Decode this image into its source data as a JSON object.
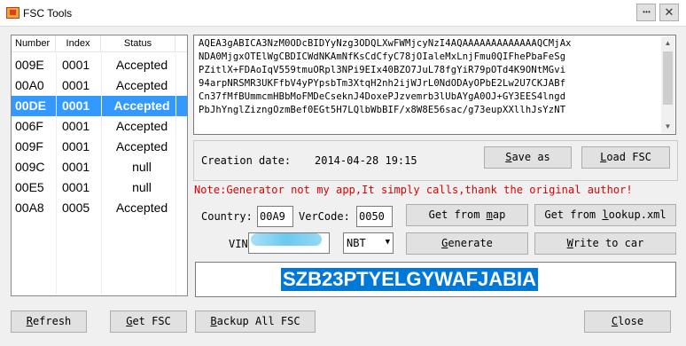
{
  "window": {
    "title": "FSC Tools",
    "help_label": "• • •",
    "close_glyph": "✕"
  },
  "listview": {
    "headers": [
      "Number",
      "Index",
      "Status"
    ],
    "rows": [
      {
        "number": "009E",
        "index": "0001",
        "status": "Accepted",
        "selected": false
      },
      {
        "number": "00A0",
        "index": "0001",
        "status": "Accepted",
        "selected": false
      },
      {
        "number": "00DE",
        "index": "0001",
        "status": "Accepted",
        "selected": true
      },
      {
        "number": "006F",
        "index": "0001",
        "status": "Accepted",
        "selected": false
      },
      {
        "number": "009F",
        "index": "0001",
        "status": "Accepted",
        "selected": false
      },
      {
        "number": "009C",
        "index": "0001",
        "status": "null",
        "selected": false
      },
      {
        "number": "00E5",
        "index": "0001",
        "status": "null",
        "selected": false
      },
      {
        "number": "00A8",
        "index": "0005",
        "status": "Accepted",
        "selected": false
      }
    ]
  },
  "key_text": [
    "AQEA3gABICA3NzM0ODcBIDYyNzg3ODQLXwFWMjcyNzI4AQAAAAAAAAAAAAAQCMjAx",
    "NDA0MjgxOTElWgCBDICWdNKAmNfKsCdCfyC78jOIaleMxLnjFmu0QIFhePbaFeSg",
    "PZitlX+FDAoIqV559tmuORpl3NPi9EIx40BZO7JuL78fgYiR79pOTd4K9ONtMGvi",
    "94arpNRSMR3UKFfbV4yPYpsbTm3XtqH2nh2ijWJrL0NdODAyOPbE2Lw2U7CKJABf",
    "Cn37fMfBUmmcmHBbMoFMDeCseknJ4DoxePJzvemrb3lUbAYgA0OJ+GY3EES4lngd",
    "PbJhYnglZizngOzmBef0EGt5H7LQlbWbBIF/x8W8E56sac/g73eupXXllhJsYzNT"
  ],
  "creation": {
    "label": "Creation date:",
    "value": "2014-04-28 19:15"
  },
  "buttons": {
    "save_as": {
      "key": "S",
      "rest": "ave as"
    },
    "load_fsc": {
      "key": "L",
      "rest": "oad FSC"
    },
    "get_from_map": {
      "pre": "Get from ",
      "key": "m",
      "rest": "ap"
    },
    "get_from_lookup": {
      "pre": "Get from ",
      "key": "l",
      "rest": "ookup.xml"
    },
    "generate": {
      "key": "G",
      "rest": "enerate"
    },
    "write_to_car": {
      "key": "W",
      "rest": "rite to car"
    },
    "refresh": {
      "key": "R",
      "rest": "efresh"
    },
    "get_fsc": {
      "key": "G",
      "rest": "et FSC"
    },
    "backup_all": {
      "key": "B",
      "rest": "ackup All FSC"
    },
    "close": {
      "key": "C",
      "rest": "lose"
    }
  },
  "note": "Note:Generator not my app,It simply calls,thank the original author!",
  "country": {
    "label": "Country:",
    "value": "00A9"
  },
  "vercode": {
    "label": "VerCode:",
    "value": "0050"
  },
  "vin": {
    "label": "VIN"
  },
  "model_select": {
    "value": "NBT",
    "arrow": "▼"
  },
  "result": "SZB23PTYELGYWAFJABIA",
  "colors": {
    "selection": "#3399ff",
    "note": "#e00000",
    "result_highlight": "#0078d7"
  }
}
